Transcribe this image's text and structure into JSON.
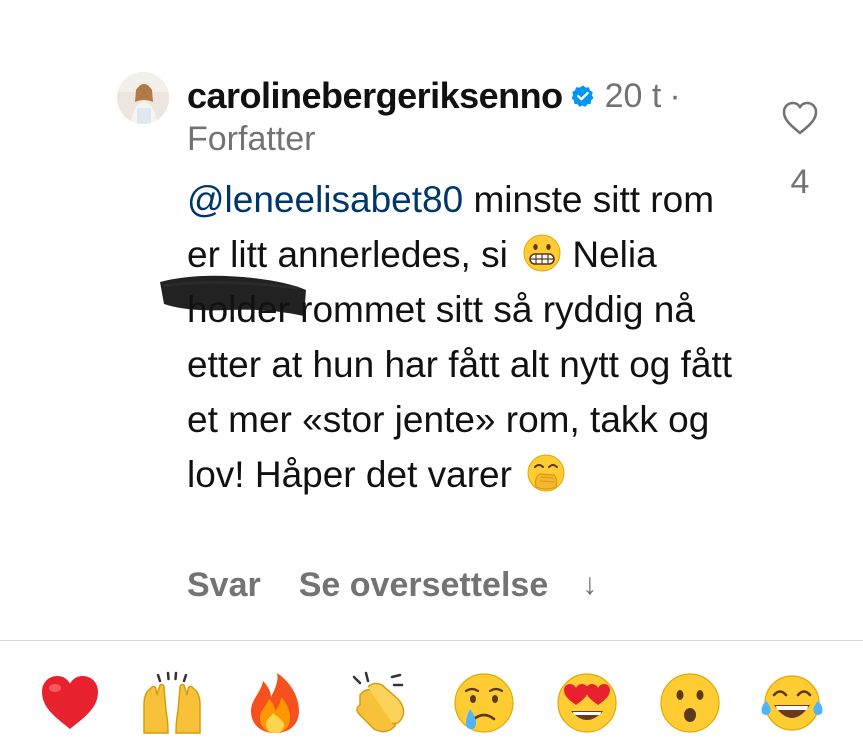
{
  "comment": {
    "username": "carolinebergeriksenno",
    "verified": true,
    "timestamp": "20 t",
    "separator": "·",
    "author_tag": "Forfatter",
    "mention": "@leneelisabet80",
    "text_segment_1": " minste sitt rom er litt annerledes, si ",
    "text_segment_2": " Nelia holder rommet sitt så ryddig nå etter at hun har fått alt nytt og fått et mer «stor jente» rom, takk og lov! Håper det varer ",
    "inline_emojis": [
      "grimacing-face-emoji",
      "face-with-open-eyes-and-hand-over-mouth-emoji"
    ],
    "like_count": "4",
    "reply_label": "Svar",
    "translate_label": "Se oversettelse",
    "translate_arrow": "↓"
  },
  "quick_reactions": [
    {
      "name": "red-heart-emoji"
    },
    {
      "name": "raising-hands-emoji"
    },
    {
      "name": "fire-emoji"
    },
    {
      "name": "clapping-hands-emoji"
    },
    {
      "name": "crying-face-emoji"
    },
    {
      "name": "heart-eyes-emoji"
    },
    {
      "name": "astonished-face-emoji"
    },
    {
      "name": "tears-of-joy-emoji"
    }
  ],
  "colors": {
    "text": "#111111",
    "secondary": "#737373",
    "mention": "#00376b",
    "verified_badge": "#0095f6",
    "divider": "#dbdbdb"
  }
}
